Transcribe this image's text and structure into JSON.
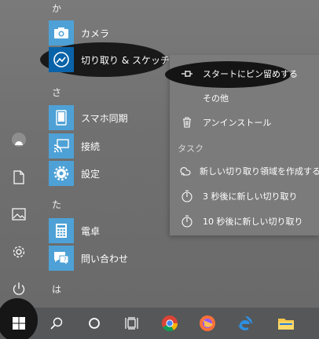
{
  "app_list": {
    "sections": [
      {
        "letter": "か",
        "apps": [
          {
            "label": "カメラ",
            "icon": "camera-icon"
          },
          {
            "label": "切り取り & スケッチ",
            "icon": "snip-sketch-icon"
          }
        ]
      },
      {
        "letter": "さ",
        "apps": [
          {
            "label": "スマホ同期",
            "icon": "phone-link-icon"
          },
          {
            "label": "接続",
            "icon": "connect-icon"
          },
          {
            "label": "設定",
            "icon": "settings-gear-icon"
          }
        ]
      },
      {
        "letter": "た",
        "apps": [
          {
            "label": "電卓",
            "icon": "calculator-icon"
          },
          {
            "label": "問い合わせ",
            "icon": "get-help-icon"
          }
        ]
      },
      {
        "letter": "は",
        "apps": []
      }
    ]
  },
  "context_menu": {
    "pin_to_start": "スタートにピン留めする",
    "more": "その他",
    "uninstall": "アンインストール",
    "tasks_header": "タスク",
    "new_snip": "新しい切り取り領域を作成する",
    "snip_in_3": "3 秒後に新しい切り取り",
    "snip_in_10": "10 秒後に新しい切り取り"
  },
  "colors": {
    "accent_tile": "#4ea1d6",
    "accent_tile_selected": "#0a63a8",
    "taskbar": "#555759"
  }
}
